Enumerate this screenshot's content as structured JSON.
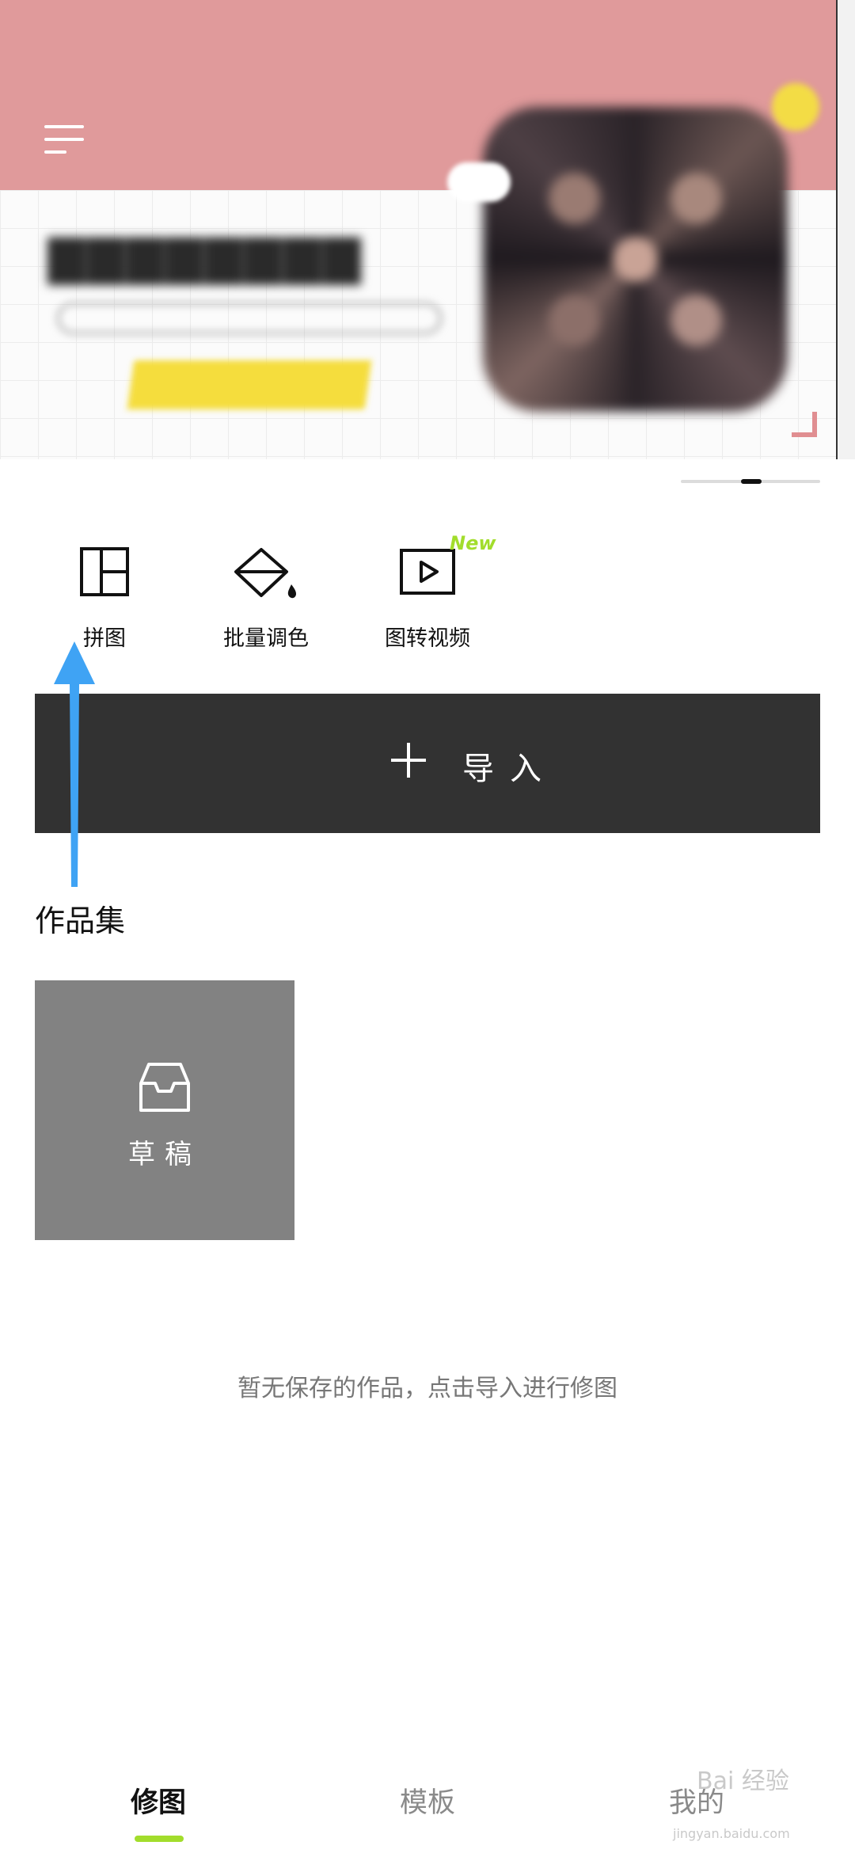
{
  "banner": {
    "menu_icon": "hamburger-menu-icon"
  },
  "tools": [
    {
      "label": "拼图",
      "icon": "collage-layout-icon"
    },
    {
      "label": "批量调色",
      "icon": "paint-bucket-icon"
    },
    {
      "label": "图转视频",
      "icon": "play-video-icon",
      "badge": "New"
    }
  ],
  "import_button": {
    "label": "导入",
    "icon": "plus-icon"
  },
  "works": {
    "title": "作品集",
    "draft_label": "草稿",
    "draft_icon": "inbox-tray-icon",
    "empty_message": "暂无保存的作品，点击导入进行修图"
  },
  "bottom_nav": {
    "items": [
      {
        "label": "修图",
        "active": true
      },
      {
        "label": "模板",
        "active": false
      },
      {
        "label": "我的",
        "active": false
      }
    ],
    "indicator_color": "#a2dd2c"
  },
  "watermark": {
    "text": "Bai 经验",
    "sub": "jingyan.baidu.com"
  },
  "colors": {
    "banner_pink": "#e09a9b",
    "import_bg": "#323232",
    "draft_bg": "#828282",
    "accent_green": "#a2dd2c",
    "annotation_arrow": "#3fa3f4"
  }
}
